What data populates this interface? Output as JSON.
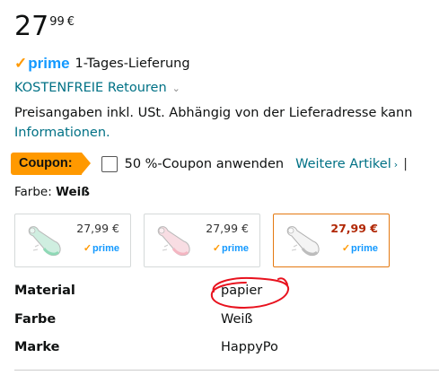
{
  "price": {
    "whole": "27",
    "fraction": "99",
    "currency": "€"
  },
  "prime": {
    "logo_text": "prime",
    "delivery": "1-Tages-Lieferung"
  },
  "returns": {
    "label": "KOSTENFREIE Retouren"
  },
  "legal": {
    "text": "Preisangaben inkl. USt. Abhängig von der Lieferadresse kann",
    "link": "Informationen."
  },
  "coupon": {
    "badge": "Coupon:",
    "text": "50 %-Coupon anwenden",
    "more_link": "Weitere Artikel",
    "separator": "|"
  },
  "color": {
    "label": "Farbe:",
    "value": "Weiß"
  },
  "swatches": [
    {
      "price": "27,99 €",
      "prime": "prime",
      "selected": false,
      "accent": "#8fd9b6"
    },
    {
      "price": "27,99 €",
      "prime": "prime",
      "selected": false,
      "accent": "#f4b6c2"
    },
    {
      "price": "27,99 €",
      "prime": "prime",
      "selected": true,
      "accent": "#ffffff"
    }
  ],
  "specs": [
    {
      "key": "Material",
      "value": "papier"
    },
    {
      "key": "Farbe",
      "value": "Weiß"
    },
    {
      "key": "Marke",
      "value": "HappyPo"
    }
  ],
  "colors": {
    "link": "#007185",
    "prime_blue": "#1399ff",
    "prime_check": "#ff9900",
    "coupon_orange": "#ff9900",
    "selected_border": "#e47911",
    "selected_price": "#b12704",
    "annotation_red": "#e8121e"
  }
}
